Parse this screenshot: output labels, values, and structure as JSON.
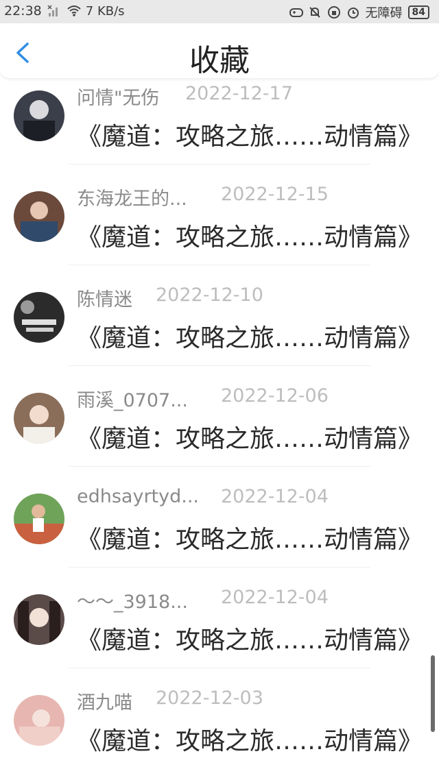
{
  "status_bar": {
    "time": "22:38",
    "network_speed": "7 KB/s",
    "accessibility": "无障碍",
    "battery": "84"
  },
  "header": {
    "title": "收藏"
  },
  "favorites": [
    {
      "user": "问情\"无伤",
      "date": "2022-12-17",
      "book": "《魔道：攻略之旅……动情篇》",
      "avatar_color": "#3b3f4a"
    },
    {
      "user": "东海龙王的...",
      "date": "2022-12-15",
      "book": "《魔道：攻略之旅……动情篇》",
      "avatar_color": "#4a4f5c"
    },
    {
      "user": "陈情迷",
      "date": "2022-12-10",
      "book": "《魔道：攻略之旅……动情篇》",
      "avatar_color": "#2b2b2b"
    },
    {
      "user": "雨溪_0707...",
      "date": "2022-12-06",
      "book": "《魔道：攻略之旅……动情篇》",
      "avatar_color": "#8a6e5a"
    },
    {
      "user": "edhsayrtyd...",
      "date": "2022-12-04",
      "book": "《魔道：攻略之旅……动情篇》",
      "avatar_color": "#c9603f"
    },
    {
      "user": "～～_3918...",
      "date": "2022-12-04",
      "book": "《魔道：攻略之旅……动情篇》",
      "avatar_color": "#5a4a48"
    },
    {
      "user": "酒九喵",
      "date": "2022-12-03",
      "book": "《魔道：攻略之旅……动情篇》",
      "avatar_color": "#e7b6b0"
    }
  ]
}
